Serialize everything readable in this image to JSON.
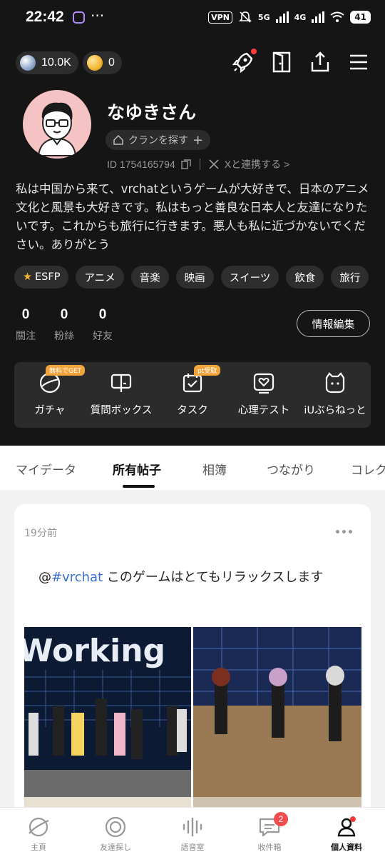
{
  "status_bar": {
    "time": "22:42",
    "dots": "···",
    "vpn": "VPN",
    "signal_5g": "5G",
    "signal_4g": "4G",
    "battery": "41"
  },
  "profile": {
    "silver_balance": "10.0K",
    "gold_balance": "0",
    "name": "なゆきさん",
    "clan_label": "クランを探す",
    "clan_plus": "+",
    "id_text": "ID 1754165794",
    "x_link": "Xと連携する >",
    "bio": "私は中国から来て、vrchatというゲームが大好きで、日本のアニメ文化と風景も大好きです。私はもっと善良な日本人と友達になりたいです。これからも旅行に行きます。悪人も私に近づかないでください。ありがとう",
    "tags": [
      "ESFP",
      "アニメ",
      "音楽",
      "映画",
      "スイーツ",
      "飲食",
      "旅行"
    ],
    "stats": [
      {
        "value": "0",
        "label": "關注"
      },
      {
        "value": "0",
        "label": "粉絲"
      },
      {
        "value": "0",
        "label": "好友"
      }
    ],
    "edit_button": "情報編集"
  },
  "features": [
    {
      "label": "ガチャ",
      "ribbon": "無料でGET",
      "icon": "gacha-icon"
    },
    {
      "label": "質問ボックス",
      "ribbon": "",
      "icon": "question-box-icon"
    },
    {
      "label": "タスク",
      "ribbon": "pt受取",
      "icon": "task-icon"
    },
    {
      "label": "心理テスト",
      "ribbon": "",
      "icon": "psych-test-icon"
    },
    {
      "label": "iUぶらねっと",
      "ribbon": "",
      "icon": "planet-icon"
    }
  ],
  "tabs": [
    "マイデータ",
    "所有帖子",
    "相簿",
    "つながり",
    "コレクション"
  ],
  "active_tab": "所有帖子",
  "post": {
    "time": "19分前",
    "mention": "@",
    "hashtag": "#vrchat",
    "text": " このゲームはとてもリラックスします",
    "image_text": "Working"
  },
  "bottom_nav": [
    {
      "label": "主頁",
      "icon": "planet-nav-icon"
    },
    {
      "label": "友達探し",
      "icon": "find-friends-icon"
    },
    {
      "label": "語音室",
      "icon": "voice-room-icon"
    },
    {
      "label": "收件箱",
      "icon": "inbox-icon",
      "badge": "2"
    },
    {
      "label": "個人資料",
      "icon": "profile-icon"
    }
  ],
  "colors": {
    "background": "#151515",
    "accent_red": "#ff3b3b",
    "hashtag": "#3b6fd8",
    "ribbon": "#f2a33a"
  }
}
